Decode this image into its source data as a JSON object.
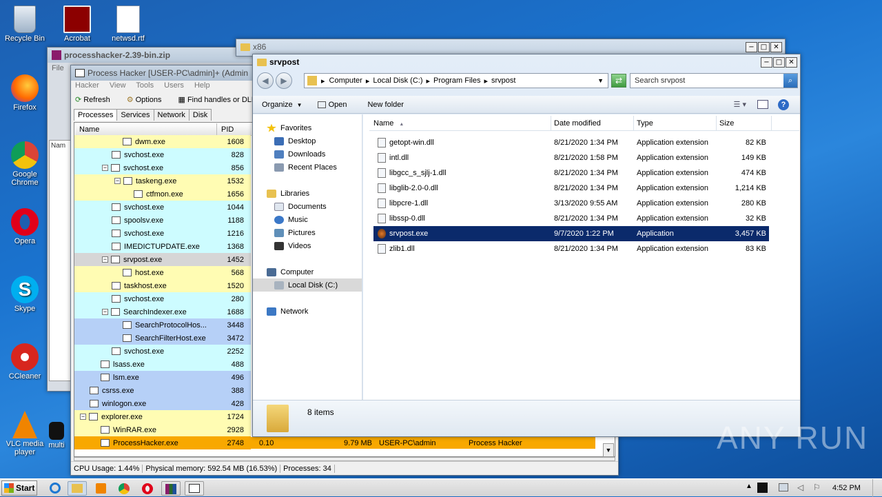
{
  "desktop_icons": [
    {
      "label": "Recycle Bin",
      "icon": "recycle-bin-icon"
    },
    {
      "label": "Acrobat",
      "icon": "acrobat-icon"
    },
    {
      "label": "netwsd.rtf",
      "icon": "word-doc-icon"
    },
    {
      "label": "Firefox",
      "icon": "firefox-icon"
    },
    {
      "label": "Google Chrome",
      "icon": "chrome-icon"
    },
    {
      "label": "Opera",
      "icon": "opera-icon"
    },
    {
      "label": "Skype",
      "icon": "skype-icon"
    },
    {
      "label": "CCleaner",
      "icon": "ccleaner-icon"
    },
    {
      "label": "VLC media player",
      "icon": "vlc-icon"
    },
    {
      "label": "multi",
      "icon": "app-icon"
    }
  ],
  "zip_window": {
    "title": "processhacker-2.39-bin.zip",
    "menu_first": "File",
    "col_partial": "Nam"
  },
  "ph": {
    "title": "Process Hacker [USER-PC\\admin]+ (Admin",
    "menu": [
      "Hacker",
      "View",
      "Tools",
      "Users",
      "Help"
    ],
    "toolbar": [
      "Refresh",
      "Options",
      "Find handles or DLL"
    ],
    "tabs": [
      "Processes",
      "Services",
      "Network",
      "Disk"
    ],
    "col_name": "Name",
    "col_pid": "PID",
    "processes": [
      {
        "name": "dwm.exe",
        "pid": "1608",
        "color": "yellow",
        "indent": 70,
        "toggle": ""
      },
      {
        "name": "svchost.exe",
        "pid": "828",
        "color": "cyan",
        "indent": 54,
        "toggle": ""
      },
      {
        "name": "svchost.exe",
        "pid": "856",
        "color": "cyan",
        "indent": 40,
        "toggle": "−"
      },
      {
        "name": "taskeng.exe",
        "pid": "1532",
        "color": "yellow",
        "indent": 58,
        "toggle": "−"
      },
      {
        "name": "ctfmon.exe",
        "pid": "1656",
        "color": "yellow",
        "indent": 86,
        "toggle": ""
      },
      {
        "name": "svchost.exe",
        "pid": "1044",
        "color": "cyan",
        "indent": 54,
        "toggle": ""
      },
      {
        "name": "spoolsv.exe",
        "pid": "1188",
        "color": "cyan",
        "indent": 54,
        "toggle": ""
      },
      {
        "name": "svchost.exe",
        "pid": "1216",
        "color": "cyan",
        "indent": 54,
        "toggle": ""
      },
      {
        "name": "IMEDICTUPDATE.exe",
        "pid": "1368",
        "color": "cyan",
        "indent": 54,
        "toggle": ""
      },
      {
        "name": "srvpost.exe",
        "pid": "1452",
        "color": "grey",
        "indent": 40,
        "toggle": "−"
      },
      {
        "name": "host.exe",
        "pid": "568",
        "color": "yellow",
        "indent": 70,
        "toggle": ""
      },
      {
        "name": "taskhost.exe",
        "pid": "1520",
        "color": "yellow",
        "indent": 54,
        "toggle": ""
      },
      {
        "name": "svchost.exe",
        "pid": "280",
        "color": "cyan",
        "indent": 54,
        "toggle": ""
      },
      {
        "name": "SearchIndexer.exe",
        "pid": "1688",
        "color": "cyan",
        "indent": 40,
        "toggle": "−"
      },
      {
        "name": "SearchProtocolHos...",
        "pid": "3448",
        "color": "blue",
        "indent": 70,
        "toggle": ""
      },
      {
        "name": "SearchFilterHost.exe",
        "pid": "3472",
        "color": "blue",
        "indent": 70,
        "toggle": ""
      },
      {
        "name": "svchost.exe",
        "pid": "2252",
        "color": "cyan",
        "indent": 54,
        "toggle": ""
      },
      {
        "name": "lsass.exe",
        "pid": "488",
        "color": "cyan",
        "indent": 38,
        "toggle": ""
      },
      {
        "name": "lsm.exe",
        "pid": "496",
        "color": "blue",
        "indent": 38,
        "toggle": ""
      },
      {
        "name": "csrss.exe",
        "pid": "388",
        "color": "blue",
        "indent": 22,
        "toggle": ""
      },
      {
        "name": "winlogon.exe",
        "pid": "428",
        "color": "blue",
        "indent": 22,
        "toggle": ""
      },
      {
        "name": "explorer.exe",
        "pid": "1724",
        "color": "yellow",
        "indent": 8,
        "toggle": "−"
      },
      {
        "name": "WinRAR.exe",
        "pid": "2928",
        "color": "yellow",
        "indent": 38,
        "toggle": ""
      },
      {
        "name": "ProcessHacker.exe",
        "pid": "2748",
        "color": "orange",
        "indent": 38,
        "toggle": ""
      }
    ],
    "selected_row": {
      "cpu": "0.10",
      "mem": "9.79 MB",
      "user": "USER-PC\\admin",
      "desc": "Process Hacker"
    },
    "status": {
      "cpu": "CPU Usage: 1.44%",
      "memory": "Physical memory: 592.54 MB (16.53%)",
      "processes": "Processes: 34"
    }
  },
  "x86_window": {
    "title": "x86"
  },
  "explorer": {
    "title": "srvpost",
    "breadcrumb": [
      "Computer",
      "Local Disk (C:)",
      "Program Files",
      "srvpost"
    ],
    "search_placeholder": "Search srvpost",
    "toolbar": {
      "organize": "Organize",
      "open": "Open",
      "new_folder": "New folder"
    },
    "nav": {
      "favorites": "Favorites",
      "fav_items": [
        "Desktop",
        "Downloads",
        "Recent Places"
      ],
      "libraries": "Libraries",
      "lib_items": [
        "Documents",
        "Music",
        "Pictures",
        "Videos"
      ],
      "computer": "Computer",
      "local_disk": "Local Disk (C:)",
      "network": "Network"
    },
    "columns": [
      "Name",
      "Date modified",
      "Type",
      "Size"
    ],
    "files": [
      {
        "name": "getopt-win.dll",
        "date": "8/21/2020 1:34 PM",
        "type": "Application extension",
        "size": "82 KB"
      },
      {
        "name": "intl.dll",
        "date": "8/21/2020 1:58 PM",
        "type": "Application extension",
        "size": "149 KB"
      },
      {
        "name": "libgcc_s_sjlj-1.dll",
        "date": "8/21/2020 1:34 PM",
        "type": "Application extension",
        "size": "474 KB"
      },
      {
        "name": "libglib-2.0-0.dll",
        "date": "8/21/2020 1:34 PM",
        "type": "Application extension",
        "size": "1,214 KB"
      },
      {
        "name": "libpcre-1.dll",
        "date": "3/13/2020 9:55 AM",
        "type": "Application extension",
        "size": "280 KB"
      },
      {
        "name": "libssp-0.dll",
        "date": "8/21/2020 1:34 PM",
        "type": "Application extension",
        "size": "32 KB"
      },
      {
        "name": "srvpost.exe",
        "date": "9/7/2020 1:22 PM",
        "type": "Application",
        "size": "3,457 KB"
      },
      {
        "name": "zlib1.dll",
        "date": "8/21/2020 1:34 PM",
        "type": "Application extension",
        "size": "83 KB"
      }
    ],
    "item_count": "8 items"
  },
  "taskbar": {
    "start": "Start",
    "clock": "4:52 PM"
  },
  "watermark": "ANY RUN"
}
